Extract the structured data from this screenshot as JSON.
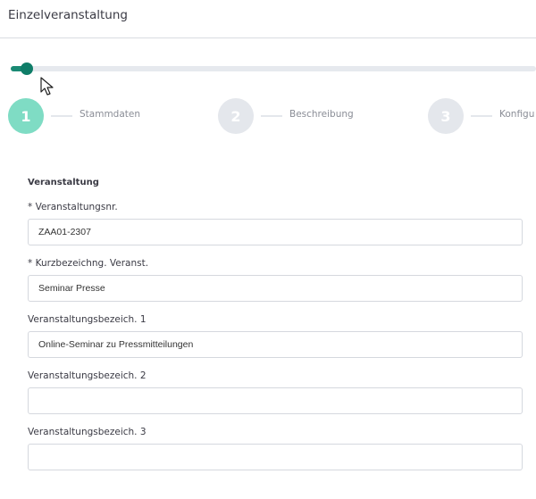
{
  "header": {
    "title": "Einzelveranstaltung"
  },
  "progress": {
    "fraction": 0.03
  },
  "steps": [
    {
      "number": "1",
      "label": "Stammdaten",
      "active": true
    },
    {
      "number": "2",
      "label": "Beschreibung",
      "active": false
    },
    {
      "number": "3",
      "label": "Konfigu",
      "active": false
    }
  ],
  "form": {
    "section_title": "Veranstaltung",
    "fields": [
      {
        "label": "* Veranstaltungsnr.",
        "value": "ZAA01-2307"
      },
      {
        "label": "* Kurzbezeichng. Veranst.",
        "value": "Seminar Presse"
      },
      {
        "label": "Veranstaltungsbezeich. 1",
        "value": "Online-Seminar zu Pressmitteilungen"
      },
      {
        "label": "Veranstaltungsbezeich. 2",
        "value": ""
      },
      {
        "label": "Veranstaltungsbezeich. 3",
        "value": ""
      }
    ]
  },
  "colors": {
    "accent": "#0f7d68",
    "active_step": "#7fdcc4",
    "inactive_step": "#e4e7ec"
  }
}
